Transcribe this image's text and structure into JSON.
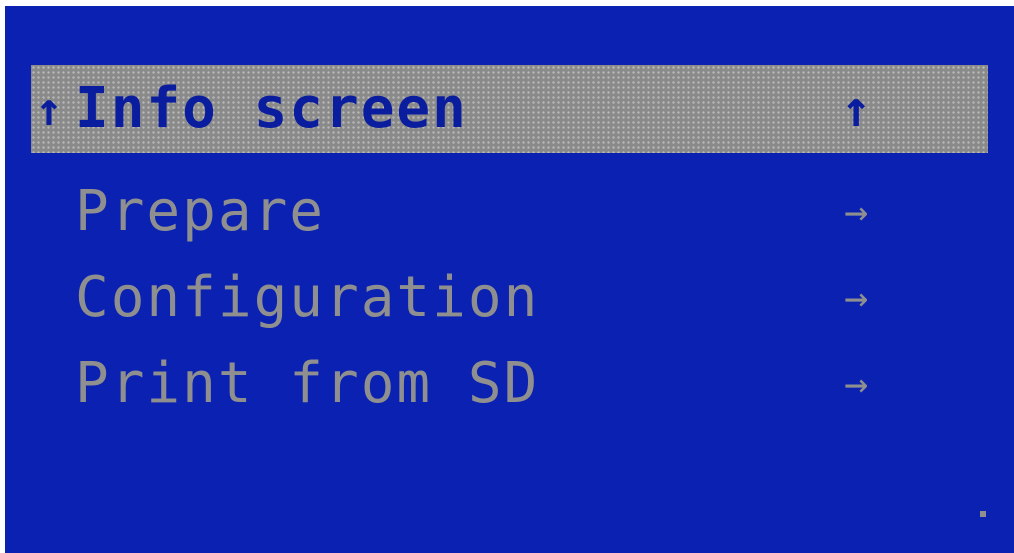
{
  "menu": {
    "items": [
      {
        "label": "Info screen",
        "indicator": "↑",
        "selected": true,
        "prefix": "↑"
      },
      {
        "label": "Prepare",
        "indicator": "→",
        "selected": false
      },
      {
        "label": "Configuration",
        "indicator": "→",
        "selected": false
      },
      {
        "label": "Print from SD",
        "indicator": "→",
        "selected": false
      }
    ]
  },
  "colors": {
    "background": "#0a21b2",
    "text": "#8f8f8f",
    "highlight": "#8a8a8a",
    "selected_text": "#0a1d9e"
  }
}
